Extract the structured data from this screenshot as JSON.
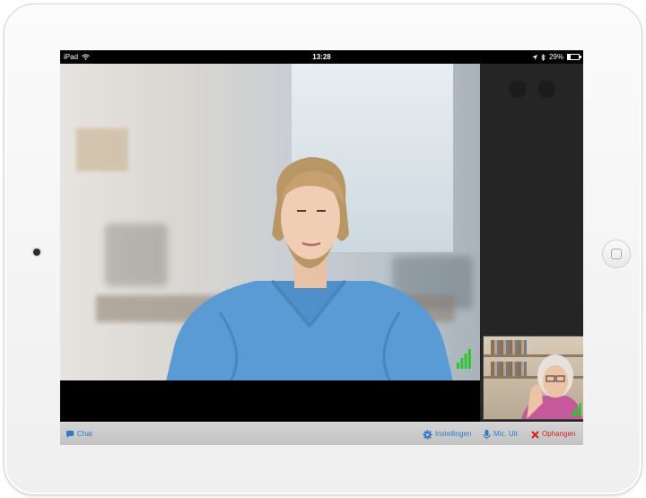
{
  "statusbar": {
    "carrier": "iPad",
    "time": "13:28",
    "battery": "29%"
  },
  "toolbar": {
    "chat_label": "Chat",
    "settings_label": "Instellingen",
    "mic_label": "Mic. Uit",
    "hangup_label": "Ophangen"
  },
  "colors": {
    "accent_blue": "#2d7cc9",
    "hangup_red": "#d42020",
    "signal_green": "#2fc52f",
    "side_panel": "#252525",
    "scrubs_blue": "#5b9bd5"
  },
  "icons": [
    "wifi-icon",
    "location-icon",
    "bluetooth-icon",
    "battery-icon",
    "chat-icon",
    "gear-icon",
    "microphone-icon",
    "close-icon",
    "signal-icon"
  ]
}
